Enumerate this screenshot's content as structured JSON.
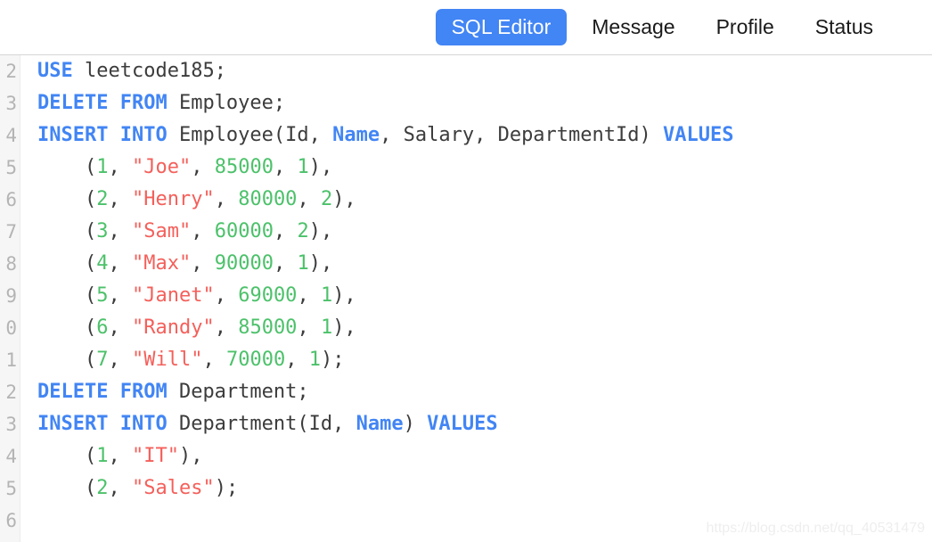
{
  "tabs": [
    {
      "label": "SQL Editor",
      "active": true
    },
    {
      "label": "Message",
      "active": false
    },
    {
      "label": "Profile",
      "active": false
    },
    {
      "label": "Status",
      "active": false
    }
  ],
  "colors": {
    "accent": "#4285f4",
    "keyword": "#4285f4",
    "number": "#4cc16a",
    "string": "#f4605b",
    "plain": "#3c3c3c",
    "gutter_bg": "#f6f6f6",
    "gutter_text": "#b4b4b4",
    "background": "#ffffff",
    "tab_border": "#d6d6d6"
  },
  "editor": {
    "line_numbers": [
      "2",
      "3",
      "4",
      "5",
      "6",
      "7",
      "8",
      "9",
      "0",
      "1",
      "2",
      "3",
      "4",
      "5",
      "6"
    ],
    "lines": [
      {
        "n": "2",
        "tokens": [
          {
            "t": "kw",
            "v": "USE"
          },
          {
            "t": "pln",
            "v": " leetcode185;"
          }
        ]
      },
      {
        "n": "3",
        "tokens": [
          {
            "t": "kw",
            "v": "DELETE FROM"
          },
          {
            "t": "pln",
            "v": " Employee;"
          }
        ]
      },
      {
        "n": "4",
        "tokens": [
          {
            "t": "kw",
            "v": "INSERT INTO"
          },
          {
            "t": "pln",
            "v": " Employee(Id, "
          },
          {
            "t": "kw",
            "v": "Name"
          },
          {
            "t": "pln",
            "v": ", Salary, DepartmentId) "
          },
          {
            "t": "kw",
            "v": "VALUES"
          }
        ]
      },
      {
        "n": "5",
        "tokens": [
          {
            "t": "pln",
            "v": "    ("
          },
          {
            "t": "num",
            "v": "1"
          },
          {
            "t": "pln",
            "v": ", "
          },
          {
            "t": "str",
            "v": "\"Joe\""
          },
          {
            "t": "pln",
            "v": ", "
          },
          {
            "t": "num",
            "v": "85000"
          },
          {
            "t": "pln",
            "v": ", "
          },
          {
            "t": "num",
            "v": "1"
          },
          {
            "t": "pln",
            "v": "),"
          }
        ]
      },
      {
        "n": "6",
        "tokens": [
          {
            "t": "pln",
            "v": "    ("
          },
          {
            "t": "num",
            "v": "2"
          },
          {
            "t": "pln",
            "v": ", "
          },
          {
            "t": "str",
            "v": "\"Henry\""
          },
          {
            "t": "pln",
            "v": ", "
          },
          {
            "t": "num",
            "v": "80000"
          },
          {
            "t": "pln",
            "v": ", "
          },
          {
            "t": "num",
            "v": "2"
          },
          {
            "t": "pln",
            "v": "),"
          }
        ]
      },
      {
        "n": "7",
        "tokens": [
          {
            "t": "pln",
            "v": "    ("
          },
          {
            "t": "num",
            "v": "3"
          },
          {
            "t": "pln",
            "v": ", "
          },
          {
            "t": "str",
            "v": "\"Sam\""
          },
          {
            "t": "pln",
            "v": ", "
          },
          {
            "t": "num",
            "v": "60000"
          },
          {
            "t": "pln",
            "v": ", "
          },
          {
            "t": "num",
            "v": "2"
          },
          {
            "t": "pln",
            "v": "),"
          }
        ]
      },
      {
        "n": "8",
        "tokens": [
          {
            "t": "pln",
            "v": "    ("
          },
          {
            "t": "num",
            "v": "4"
          },
          {
            "t": "pln",
            "v": ", "
          },
          {
            "t": "str",
            "v": "\"Max\""
          },
          {
            "t": "pln",
            "v": ", "
          },
          {
            "t": "num",
            "v": "90000"
          },
          {
            "t": "pln",
            "v": ", "
          },
          {
            "t": "num",
            "v": "1"
          },
          {
            "t": "pln",
            "v": "),"
          }
        ]
      },
      {
        "n": "9",
        "tokens": [
          {
            "t": "pln",
            "v": "    ("
          },
          {
            "t": "num",
            "v": "5"
          },
          {
            "t": "pln",
            "v": ", "
          },
          {
            "t": "str",
            "v": "\"Janet\""
          },
          {
            "t": "pln",
            "v": ", "
          },
          {
            "t": "num",
            "v": "69000"
          },
          {
            "t": "pln",
            "v": ", "
          },
          {
            "t": "num",
            "v": "1"
          },
          {
            "t": "pln",
            "v": "),"
          }
        ]
      },
      {
        "n": "0",
        "tokens": [
          {
            "t": "pln",
            "v": "    ("
          },
          {
            "t": "num",
            "v": "6"
          },
          {
            "t": "pln",
            "v": ", "
          },
          {
            "t": "str",
            "v": "\"Randy\""
          },
          {
            "t": "pln",
            "v": ", "
          },
          {
            "t": "num",
            "v": "85000"
          },
          {
            "t": "pln",
            "v": ", "
          },
          {
            "t": "num",
            "v": "1"
          },
          {
            "t": "pln",
            "v": "),"
          }
        ]
      },
      {
        "n": "1",
        "tokens": [
          {
            "t": "pln",
            "v": "    ("
          },
          {
            "t": "num",
            "v": "7"
          },
          {
            "t": "pln",
            "v": ", "
          },
          {
            "t": "str",
            "v": "\"Will\""
          },
          {
            "t": "pln",
            "v": ", "
          },
          {
            "t": "num",
            "v": "70000"
          },
          {
            "t": "pln",
            "v": ", "
          },
          {
            "t": "num",
            "v": "1"
          },
          {
            "t": "pln",
            "v": ");"
          }
        ]
      },
      {
        "n": "2",
        "tokens": [
          {
            "t": "kw",
            "v": "DELETE FROM"
          },
          {
            "t": "pln",
            "v": " Department;"
          }
        ]
      },
      {
        "n": "3",
        "tokens": [
          {
            "t": "kw",
            "v": "INSERT INTO"
          },
          {
            "t": "pln",
            "v": " Department(Id, "
          },
          {
            "t": "kw",
            "v": "Name"
          },
          {
            "t": "pln",
            "v": ") "
          },
          {
            "t": "kw",
            "v": "VALUES"
          }
        ]
      },
      {
        "n": "4",
        "tokens": [
          {
            "t": "pln",
            "v": "    ("
          },
          {
            "t": "num",
            "v": "1"
          },
          {
            "t": "pln",
            "v": ", "
          },
          {
            "t": "str",
            "v": "\"IT\""
          },
          {
            "t": "pln",
            "v": "),"
          }
        ]
      },
      {
        "n": "5",
        "tokens": [
          {
            "t": "pln",
            "v": "    ("
          },
          {
            "t": "num",
            "v": "2"
          },
          {
            "t": "pln",
            "v": ", "
          },
          {
            "t": "str",
            "v": "\"Sales\""
          },
          {
            "t": "pln",
            "v": ");"
          }
        ]
      },
      {
        "n": "6",
        "tokens": []
      }
    ]
  },
  "watermark": {
    "text": "https://blog.csdn.net/qq_40531479"
  }
}
